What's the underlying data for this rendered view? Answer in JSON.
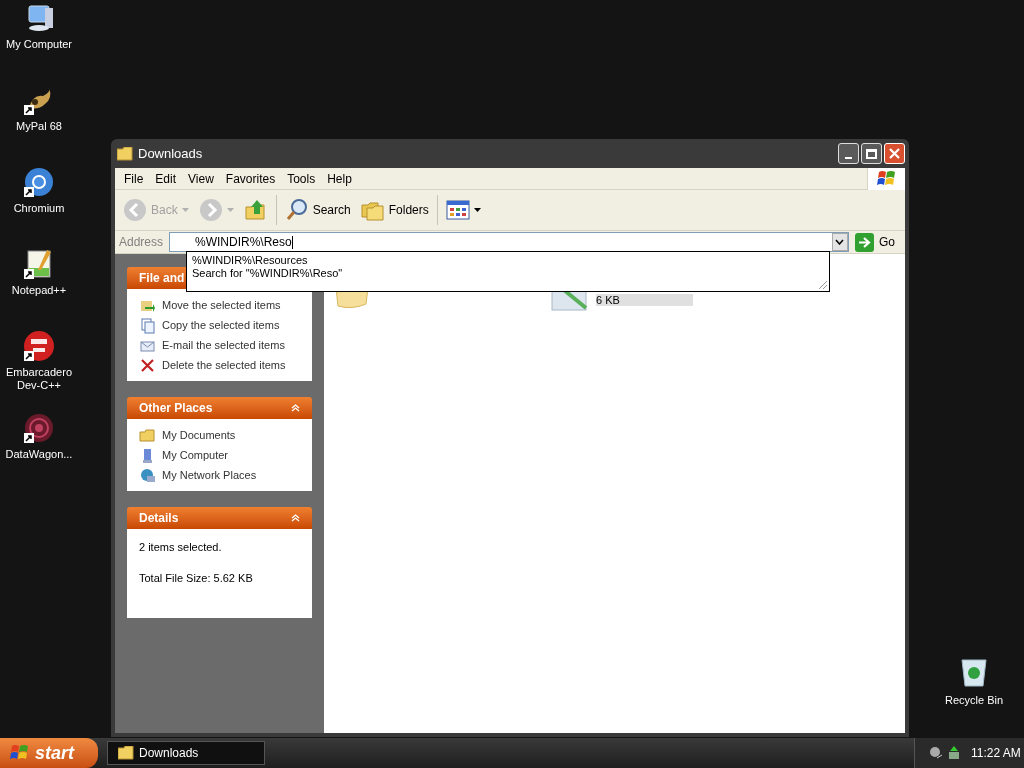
{
  "desktop_icons": [
    {
      "label": "My Computer",
      "kind": "computer",
      "shortcut": false
    },
    {
      "label": "MyPal 68",
      "kind": "pal",
      "shortcut": true
    },
    {
      "label": "Chromium",
      "kind": "chromium",
      "shortcut": true
    },
    {
      "label": "Notepad++",
      "kind": "notepad",
      "shortcut": true
    },
    {
      "label": "Embarcadero Dev-C++",
      "kind": "devcpp",
      "shortcut": true
    },
    {
      "label": "DataWagon...",
      "kind": "datawagon",
      "shortcut": true
    }
  ],
  "recycle_bin": {
    "label": "Recycle Bin"
  },
  "window": {
    "title": "Downloads",
    "menu": [
      "File",
      "Edit",
      "View",
      "Favorites",
      "Tools",
      "Help"
    ],
    "toolbar": [
      {
        "kind": "back",
        "label": "Back",
        "disabled": true
      },
      {
        "kind": "forward",
        "disabled": true
      },
      {
        "kind": "up"
      },
      {
        "kind": "search",
        "label": "Search",
        "disabled": false
      },
      {
        "kind": "folders",
        "label": "Folders",
        "disabled": false
      },
      {
        "kind": "views"
      }
    ],
    "address": {
      "label": "Address",
      "value": "%WINDIR%\\Reso",
      "go": "Go"
    },
    "autocomplete": [
      "%WINDIR%\\Resources",
      "Search for \"%WINDIR%\\Reso\""
    ],
    "panes": [
      {
        "title": "File and",
        "items": [
          {
            "kind": "move",
            "label": "Move the selected items"
          },
          {
            "kind": "copy",
            "label": "Copy the selected items"
          },
          {
            "kind": "email",
            "label": "E-mail the selected items"
          },
          {
            "kind": "delete",
            "label": "Delete the selected items"
          }
        ]
      },
      {
        "title": "Other Places",
        "collapsible": true,
        "items": [
          {
            "kind": "documents",
            "label": "My Documents"
          },
          {
            "kind": "computer",
            "label": "My Computer"
          },
          {
            "kind": "network",
            "label": "My Network Places"
          }
        ]
      },
      {
        "title": "Details",
        "collapsible": true,
        "lines": [
          "2 items selected.",
          "Total File Size: 5.62 KB"
        ]
      }
    ],
    "files": [
      {
        "kind": "folder"
      },
      {
        "kind": "file",
        "size": "6 KB",
        "selected": true
      }
    ]
  },
  "taskbar": {
    "start": "start",
    "tasks": [
      {
        "label": "Downloads",
        "selected": true
      }
    ],
    "clock": "11:22 AM"
  }
}
